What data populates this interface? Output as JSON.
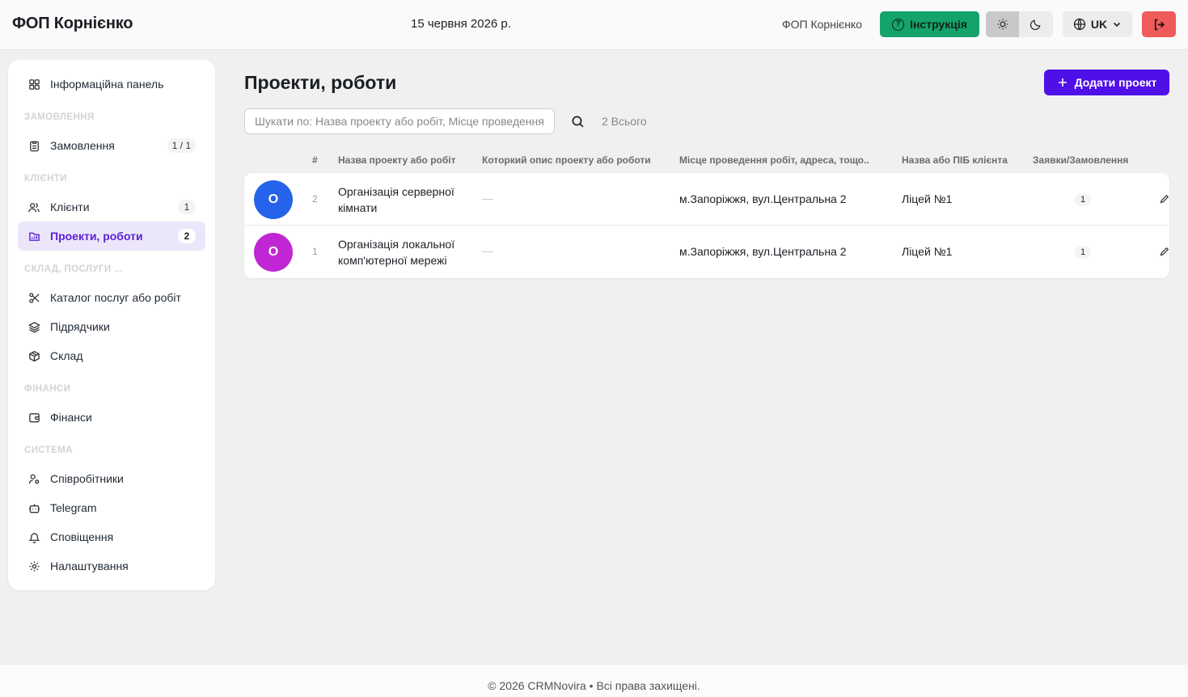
{
  "header": {
    "brand": "ФОП Корнієнко",
    "date": "15 червня 2026 р.",
    "user_name": "ФОП Корнієнко",
    "instruction_label": "Інструкція",
    "language": "UK"
  },
  "sidebar": {
    "dashboard": "Інформаційна панель",
    "sections": {
      "orders": "ЗАМОВЛЕННЯ",
      "clients": "КЛІЄНТИ",
      "warehouse": "СКЛАД, ПОСЛУГИ ...",
      "finance": "ФІНАНСИ",
      "system": "СИСТЕМА"
    },
    "items": {
      "orders": {
        "label": "Замовлення",
        "badge": "1 / 1"
      },
      "clients": {
        "label": "Клієнти",
        "badge": "1"
      },
      "projects": {
        "label": "Проекти, роботи",
        "badge": "2"
      },
      "catalog": {
        "label": "Каталог послуг або робіт"
      },
      "contractors": {
        "label": "Підрядчики"
      },
      "warehouse": {
        "label": "Склад"
      },
      "finance": {
        "label": "Фінанси"
      },
      "employees": {
        "label": "Співробітники"
      },
      "telegram": {
        "label": "Telegram"
      },
      "notifications": {
        "label": "Сповіщення"
      },
      "settings": {
        "label": "Налаштування"
      }
    }
  },
  "main": {
    "title": "Проекти, роботи",
    "add_button": "Додати проект",
    "search_placeholder": "Шукати по: Назва проекту або робіт, Місце проведення робіт",
    "total": "2 Всього",
    "columns": {
      "num": "#",
      "name": "Назва проекту або робіт",
      "description": "Которкий опис проекту або роботи",
      "place": "Місце проведення робіт, адреса, тощо..",
      "client": "Назва або ПІБ клієнта",
      "orders": "Заявки/Замовлення"
    },
    "rows": [
      {
        "avatar": "О",
        "avatar_color": "#2563eb",
        "num": "2",
        "name": "Організація серверної кімнати",
        "description": "—",
        "place": "м.Запоріжжя, вул.Центральна 2",
        "client": "Ліцей №1",
        "orders": "1"
      },
      {
        "avatar": "О",
        "avatar_color": "#c026d3",
        "num": "1",
        "name": "Організація локальної комп'ютерної мережі",
        "description": "—",
        "place": "м.Запоріжжя, вул.Центральна 2",
        "client": "Ліцей №1",
        "orders": "1"
      }
    ]
  },
  "footer": {
    "text": "© 2026 CRMNovira • Всі права захищені."
  },
  "colors": {
    "accent": "#4f10e8",
    "instruction": "#14a36b",
    "logout": "#ef5b5b",
    "active_nav_bg": "#ece6fb"
  }
}
